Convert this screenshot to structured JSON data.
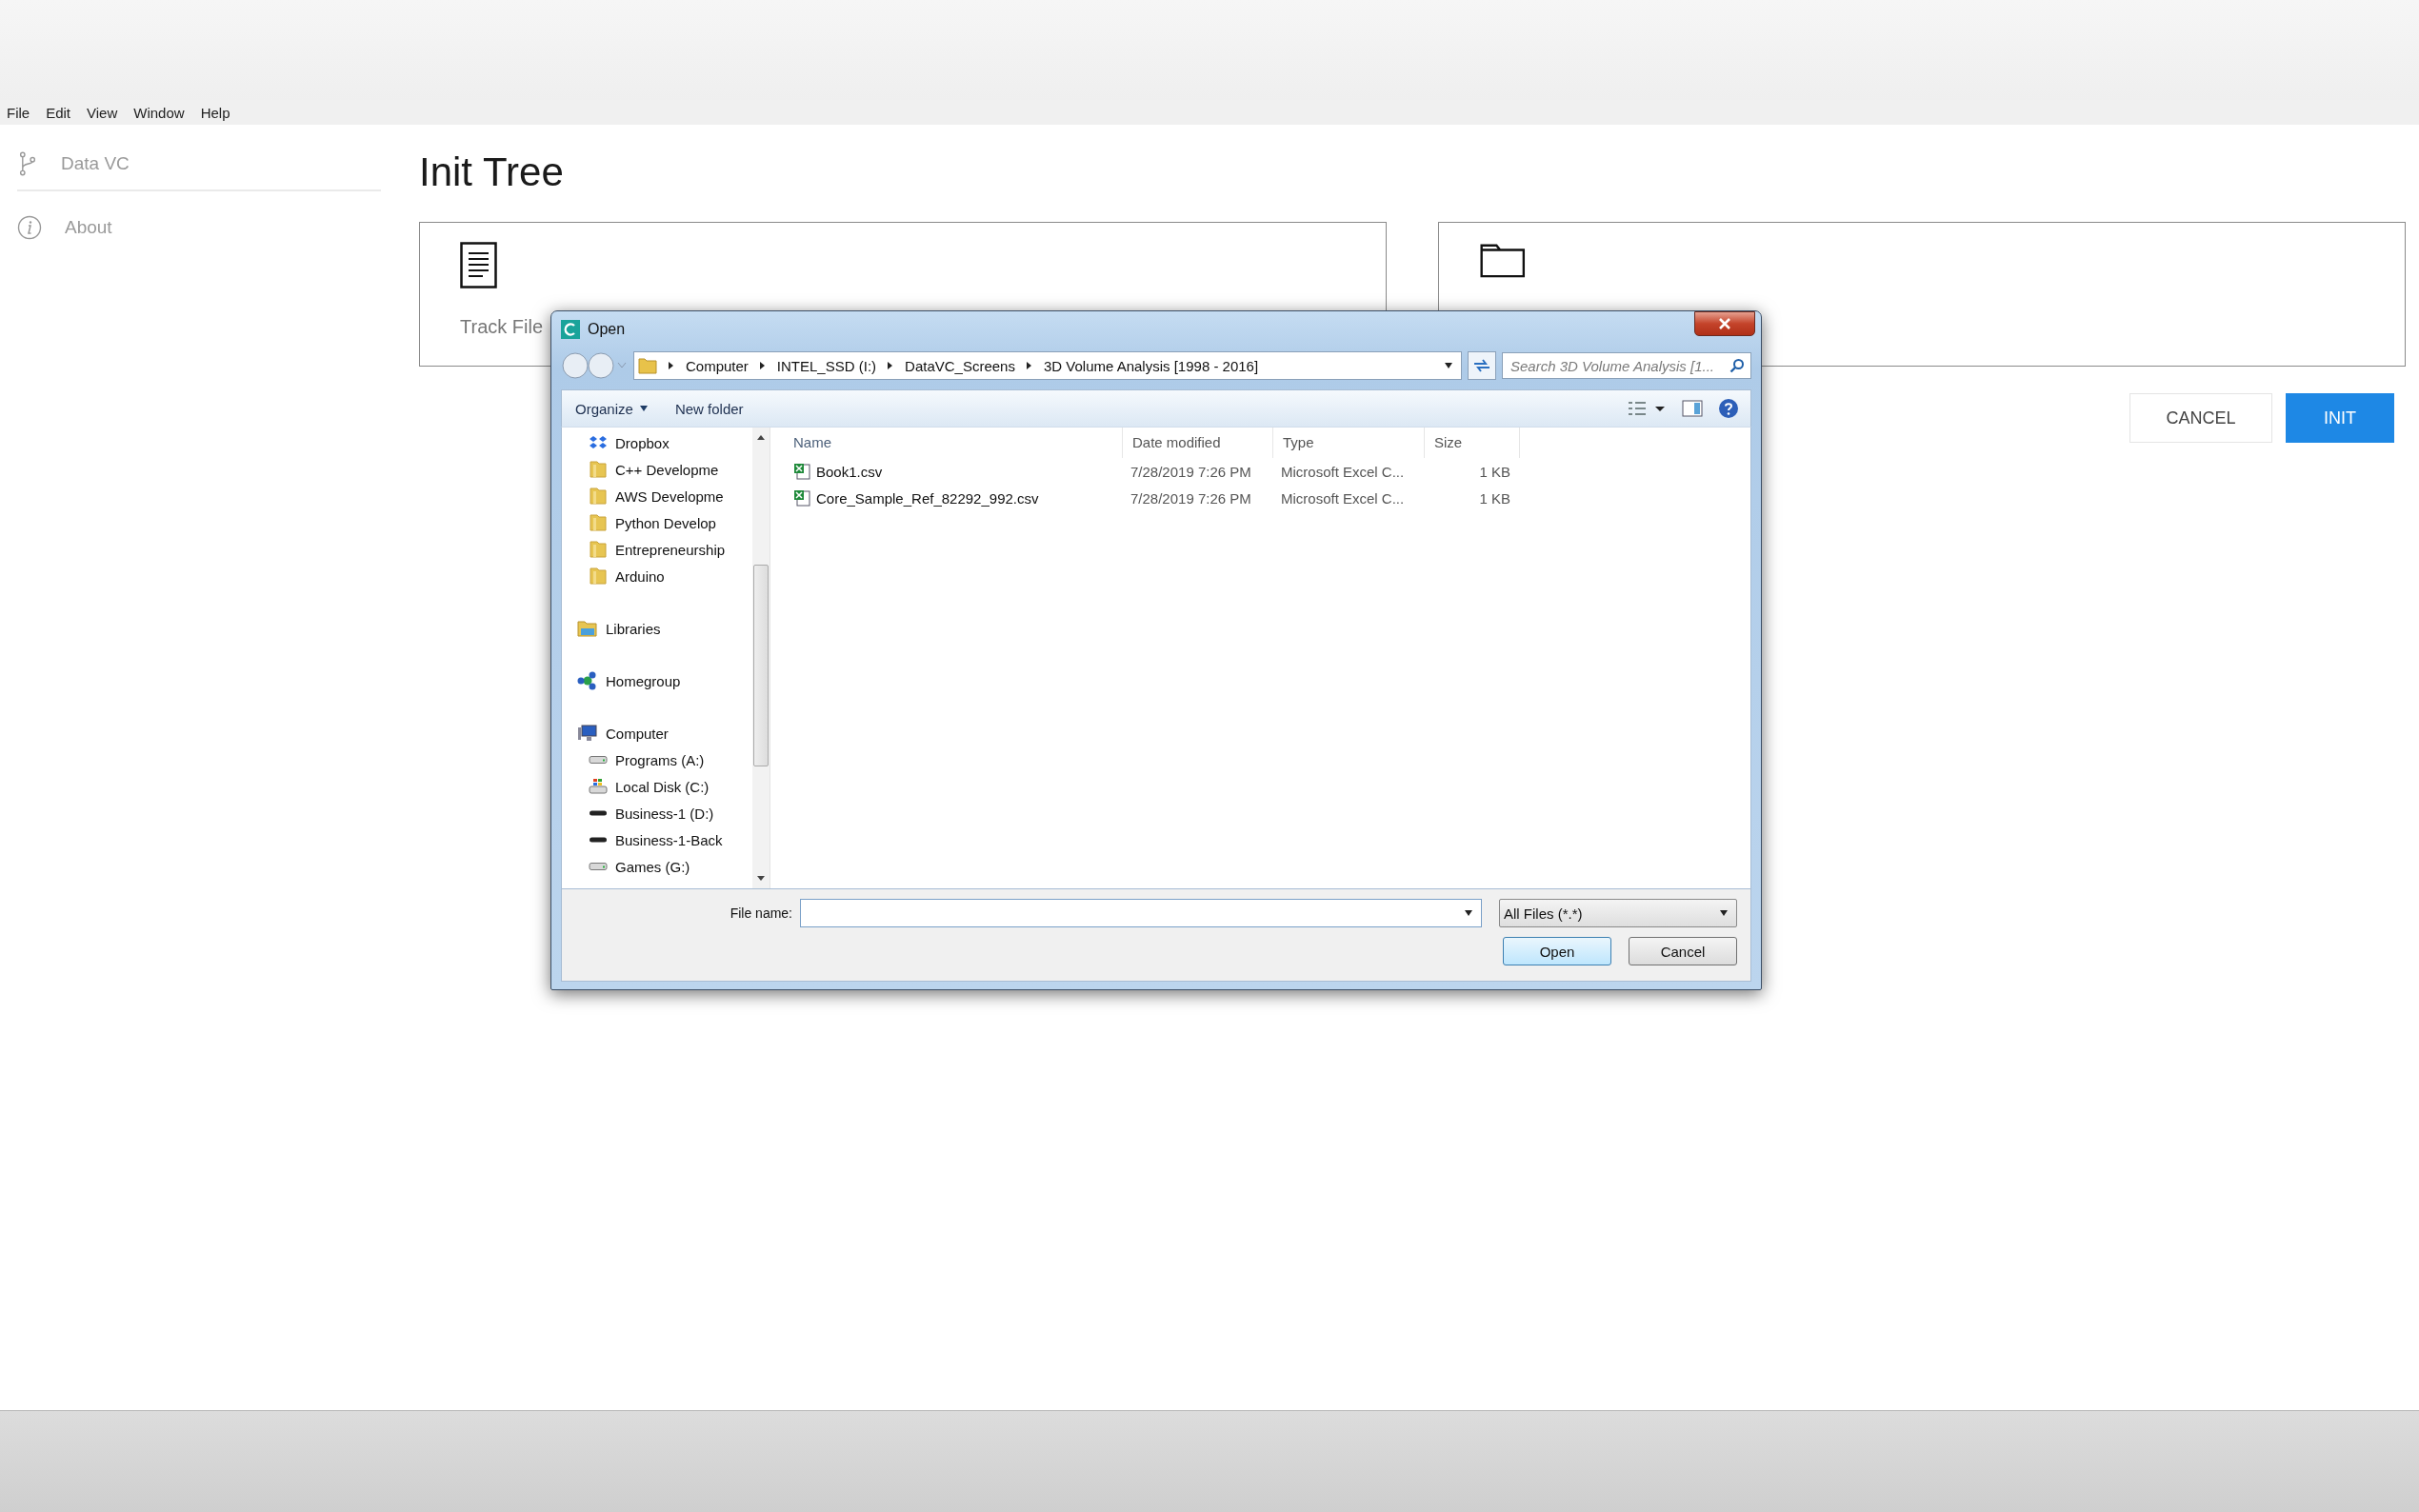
{
  "menu": [
    "File",
    "Edit",
    "View",
    "Window",
    "Help"
  ],
  "sidebar": [
    {
      "label": "Data VC",
      "kind": "branch"
    },
    {
      "label": "About",
      "kind": "info"
    }
  ],
  "page": {
    "title": "Init Tree",
    "cards": [
      {
        "label": "Track File",
        "kind": "file"
      },
      {
        "kind": "folder"
      }
    ],
    "buttons": [
      {
        "label": "CANCEL",
        "kind": "secondary"
      },
      {
        "label": "INIT",
        "kind": "primary"
      }
    ]
  },
  "dialog": {
    "title": "Open",
    "breadcrumb": [
      "Computer",
      "INTEL_SSD (I:)",
      "DataVC_Screens",
      "3D Volume Analysis [1998 - 2016]"
    ],
    "search": {
      "placeholder": "Search 3D Volume Analysis [1..."
    },
    "toolbar": [
      "Organize",
      "New folder"
    ],
    "favorites": [
      {
        "label": "Dropbox",
        "kind": "dropbox"
      },
      {
        "label": "C++ Developme",
        "kind": "folder"
      },
      {
        "label": "AWS Developme",
        "kind": "folder"
      },
      {
        "label": "Python Develop",
        "kind": "folder"
      },
      {
        "label": "Entrepreneurship",
        "kind": "folder"
      },
      {
        "label": "Arduino",
        "kind": "folder"
      }
    ],
    "nav": [
      {
        "label": "Libraries",
        "kind": "libraries"
      },
      {
        "label": "Homegroup",
        "kind": "homegroup"
      },
      {
        "label": "Computer",
        "kind": "computer",
        "children": [
          {
            "label": "Programs (A:)",
            "kind": "drive"
          },
          {
            "label": "Local Disk (C:)",
            "kind": "windrive"
          },
          {
            "label": "Business-1 (D:)",
            "kind": "darkdrive"
          },
          {
            "label": "Business-1-Back",
            "kind": "darkdrive"
          },
          {
            "label": "Games (G:)",
            "kind": "drive"
          }
        ]
      }
    ],
    "columns": [
      "Name",
      "Date modified",
      "Type",
      "Size"
    ],
    "files": [
      {
        "name": "Book1.csv",
        "date": "7/28/2019 7:26 PM",
        "type": "Microsoft Excel C...",
        "size": "1 KB"
      },
      {
        "name": "Core_Sample_Ref_82292_992.csv",
        "date": "7/28/2019 7:26 PM",
        "type": "Microsoft Excel C...",
        "size": "1 KB"
      }
    ],
    "file_name_label": "File name:",
    "filter": "All Files (*.*)",
    "actions": [
      {
        "label": "Open",
        "kind": "default"
      },
      {
        "label": "Cancel",
        "kind": "normal"
      }
    ]
  }
}
